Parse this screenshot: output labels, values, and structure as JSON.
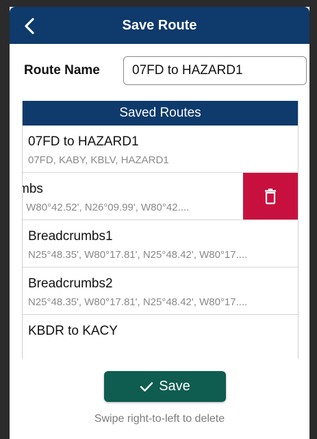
{
  "header": {
    "title": "Save Route",
    "back_icon": "chevron-left-icon"
  },
  "form": {
    "route_name_label": "Route Name",
    "route_name_value": "07FD to HAZARD1"
  },
  "saved_routes": {
    "title": "Saved Routes",
    "items": [
      {
        "name": "07FD to HAZARD1",
        "detail": "07FD, KABY, KBLV, HAZARD1"
      },
      {
        "name": "mbs",
        "detail": "', W80°42.52', N26°09.99', W80°42...."
      },
      {
        "name": "Breadcrumbs1",
        "detail": "N25°48.35', W80°17.81', N25°48.42', W80°17...."
      },
      {
        "name": "Breadcrumbs2",
        "detail": "N25°48.35', W80°17.81', N25°48.42', W80°17...."
      },
      {
        "name": "KBDR to KACY",
        "detail": ""
      }
    ],
    "delete_icon": "trash-icon"
  },
  "actions": {
    "save_label": "Save",
    "save_icon": "checkmark-icon"
  },
  "hint": "Swipe right-to-left to delete",
  "colors": {
    "header": "#0e3a6c",
    "delete": "#c8103e",
    "save": "#0f5c50"
  }
}
